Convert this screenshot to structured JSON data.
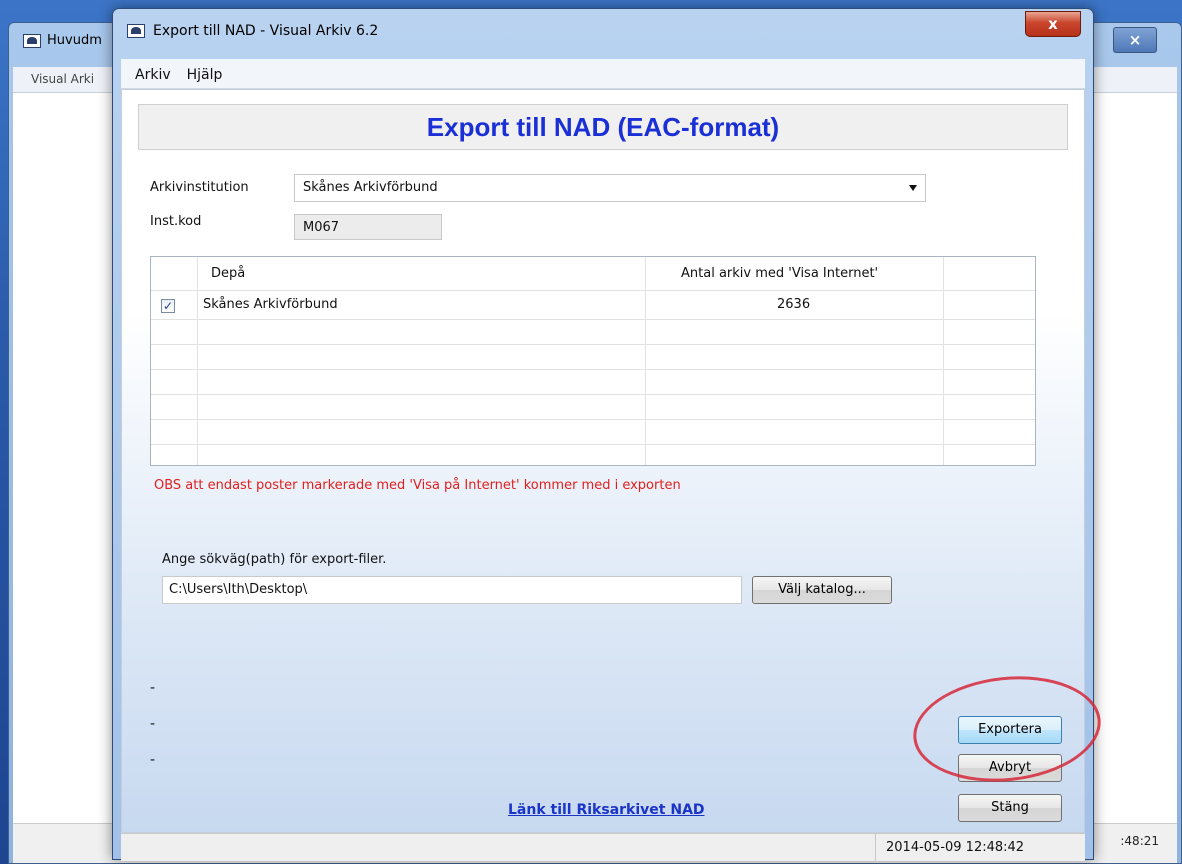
{
  "background_window": {
    "title": "Huvudm",
    "menu_text": "Visual Arki",
    "status_time": ":48:21"
  },
  "dialog": {
    "title": "Export till NAD - Visual Arkiv 6.2",
    "close_label": "x",
    "menu": [
      "Arkiv",
      "Hjälp"
    ],
    "header": "Export till NAD (EAC-format)",
    "institution_label": "Arkivinstitution",
    "institution_value": "Skånes Arkivförbund",
    "instkod_label": "Inst.kod",
    "instkod_value": "M067",
    "grid": {
      "columns": [
        "Depå",
        "Antal arkiv med 'Visa Internet'"
      ],
      "rows": [
        {
          "checked": "✓",
          "depa": "Skånes Arkivförbund",
          "antal": "2636"
        }
      ]
    },
    "warning": "OBS att endast poster markerade med 'Visa på Internet' kommer med i exporten",
    "path_label": "Ange sökväg(path)  för export-filer.",
    "path_value": "C:\\Users\\Ith\\Desktop\\",
    "choose_dir_label": "Välj katalog...",
    "dashes": [
      "-",
      "-",
      "-"
    ],
    "export_label": "Exportera",
    "cancel_label": "Avbryt",
    "close_button_label": "Stäng",
    "link_text": "Länk till Riksarkivet NAD",
    "status_datetime": "2014-05-09 12:48:42"
  }
}
